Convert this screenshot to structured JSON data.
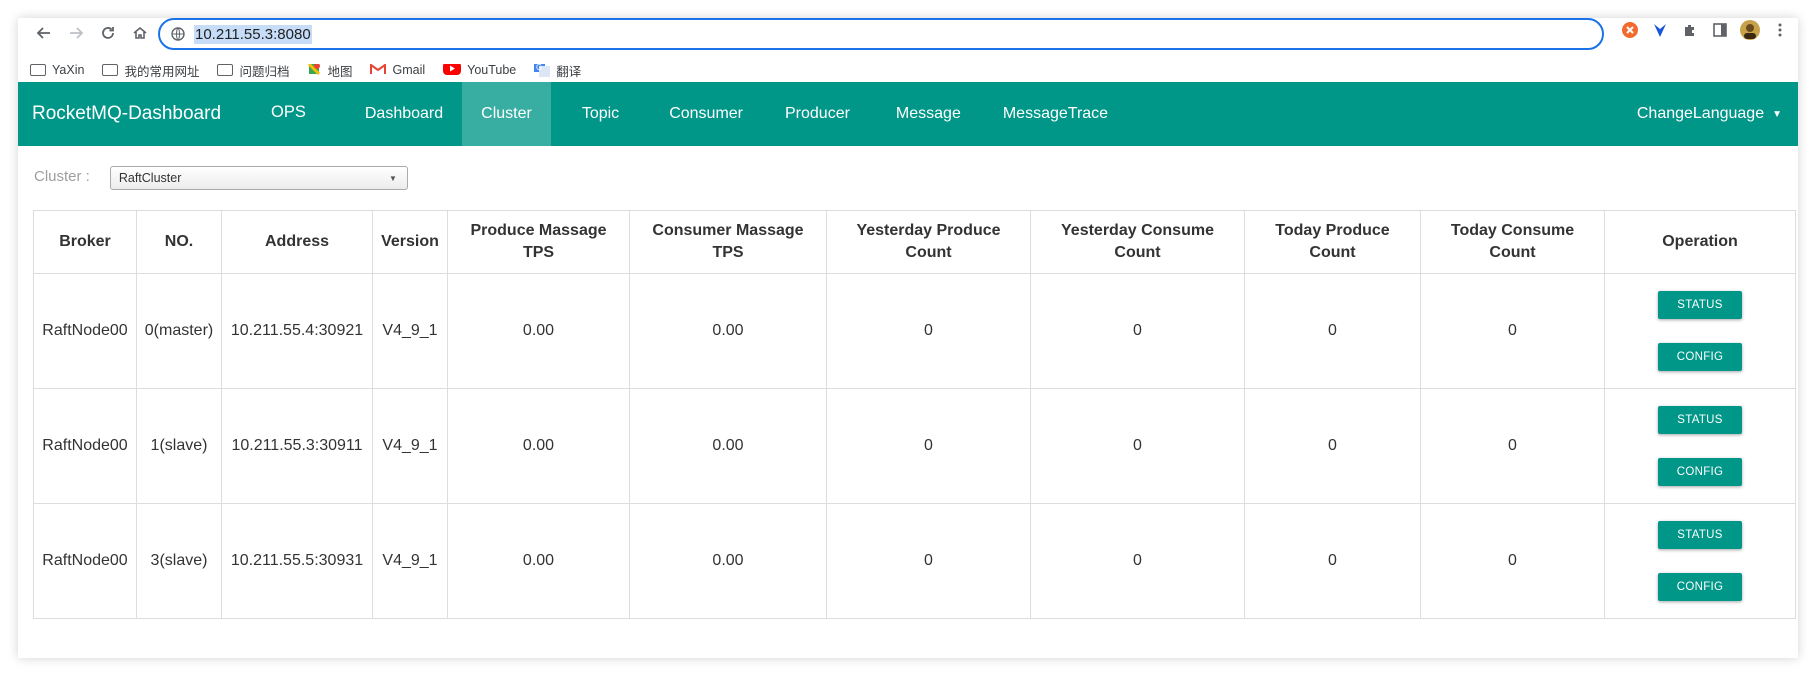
{
  "browser": {
    "url": "10.211.55.3:8080",
    "bookmarks": [
      {
        "label": "YaXin",
        "icon": "folder-icon"
      },
      {
        "label": "我的常用网址",
        "icon": "folder-icon"
      },
      {
        "label": "问题归档",
        "icon": "folder-icon"
      },
      {
        "label": "地图",
        "icon": "maps-icon"
      },
      {
        "label": "Gmail",
        "icon": "gmail-icon"
      },
      {
        "label": "YouTube",
        "icon": "youtube-icon"
      },
      {
        "label": "翻译",
        "icon": "translate-icon"
      }
    ]
  },
  "nav": {
    "brand": "RocketMQ-Dashboard",
    "items": [
      "OPS",
      "Dashboard",
      "Cluster",
      "Topic",
      "Consumer",
      "Producer",
      "Message",
      "MessageTrace"
    ],
    "active": "Cluster",
    "change_language": "ChangeLanguage"
  },
  "cluster": {
    "label": "Cluster :",
    "selected": "RaftCluster"
  },
  "table": {
    "headers": [
      "Broker",
      "NO.",
      "Address",
      "Version",
      "Produce Massage TPS",
      "Consumer Massage TPS",
      "Yesterday Produce Count",
      "Yesterday Consume Count",
      "Today Produce Count",
      "Today Consume Count",
      "Operation"
    ],
    "rows": [
      {
        "broker": "RaftNode00",
        "no": "0(master)",
        "address": "10.211.55.4:30921",
        "version": "V4_9_1",
        "produce_tps": "0.00",
        "consume_tps": "0.00",
        "y_produce": "0",
        "y_consume": "0",
        "t_produce": "0",
        "t_consume": "0"
      },
      {
        "broker": "RaftNode00",
        "no": "1(slave)",
        "address": "10.211.55.3:30911",
        "version": "V4_9_1",
        "produce_tps": "0.00",
        "consume_tps": "0.00",
        "y_produce": "0",
        "y_consume": "0",
        "t_produce": "0",
        "t_consume": "0"
      },
      {
        "broker": "RaftNode00",
        "no": "3(slave)",
        "address": "10.211.55.5:30931",
        "version": "V4_9_1",
        "produce_tps": "0.00",
        "consume_tps": "0.00",
        "y_produce": "0",
        "y_consume": "0",
        "t_produce": "0",
        "t_consume": "0"
      }
    ],
    "status_label": "STATUS",
    "config_label": "CONFIG"
  },
  "colors": {
    "primary": "#009688",
    "omnibox_focus": "#1a73e8"
  }
}
